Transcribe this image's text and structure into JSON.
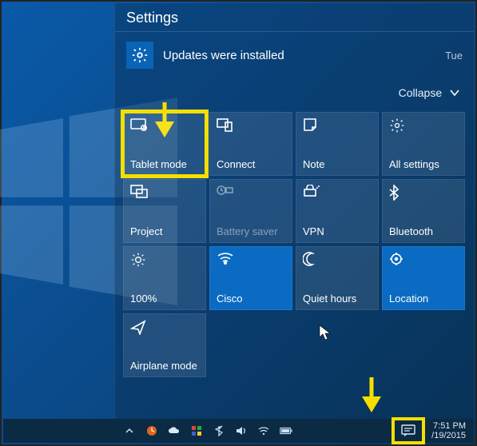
{
  "panel": {
    "title": "Settings",
    "notification": {
      "text": "Updates were installed",
      "day": "Tue"
    },
    "collapse_label": "Collapse"
  },
  "tiles": [
    [
      {
        "label": "Tablet mode",
        "icon": "tablet",
        "active": false,
        "highlight": true
      },
      {
        "label": "Connect",
        "icon": "connect",
        "active": false
      },
      {
        "label": "Note",
        "icon": "note",
        "active": false
      },
      {
        "label": "All settings",
        "icon": "gear",
        "active": false
      }
    ],
    [
      {
        "label": "Project",
        "icon": "project",
        "active": false
      },
      {
        "label": "Battery saver",
        "icon": "battery",
        "active": false,
        "dim": true
      },
      {
        "label": "VPN",
        "icon": "vpn",
        "active": false
      },
      {
        "label": "Bluetooth",
        "icon": "bluetooth",
        "active": false
      }
    ],
    [
      {
        "label": "100%",
        "icon": "brightness",
        "active": false
      },
      {
        "label": "Cisco",
        "icon": "wifi",
        "active": true
      },
      {
        "label": "Quiet hours",
        "icon": "moon",
        "active": false
      },
      {
        "label": "Location",
        "icon": "location",
        "active": true
      }
    ],
    [
      {
        "label": "Airplane mode",
        "icon": "airplane",
        "active": false
      }
    ]
  ],
  "taskbar": {
    "time": "7:51 PM",
    "date": "/19/2015"
  }
}
